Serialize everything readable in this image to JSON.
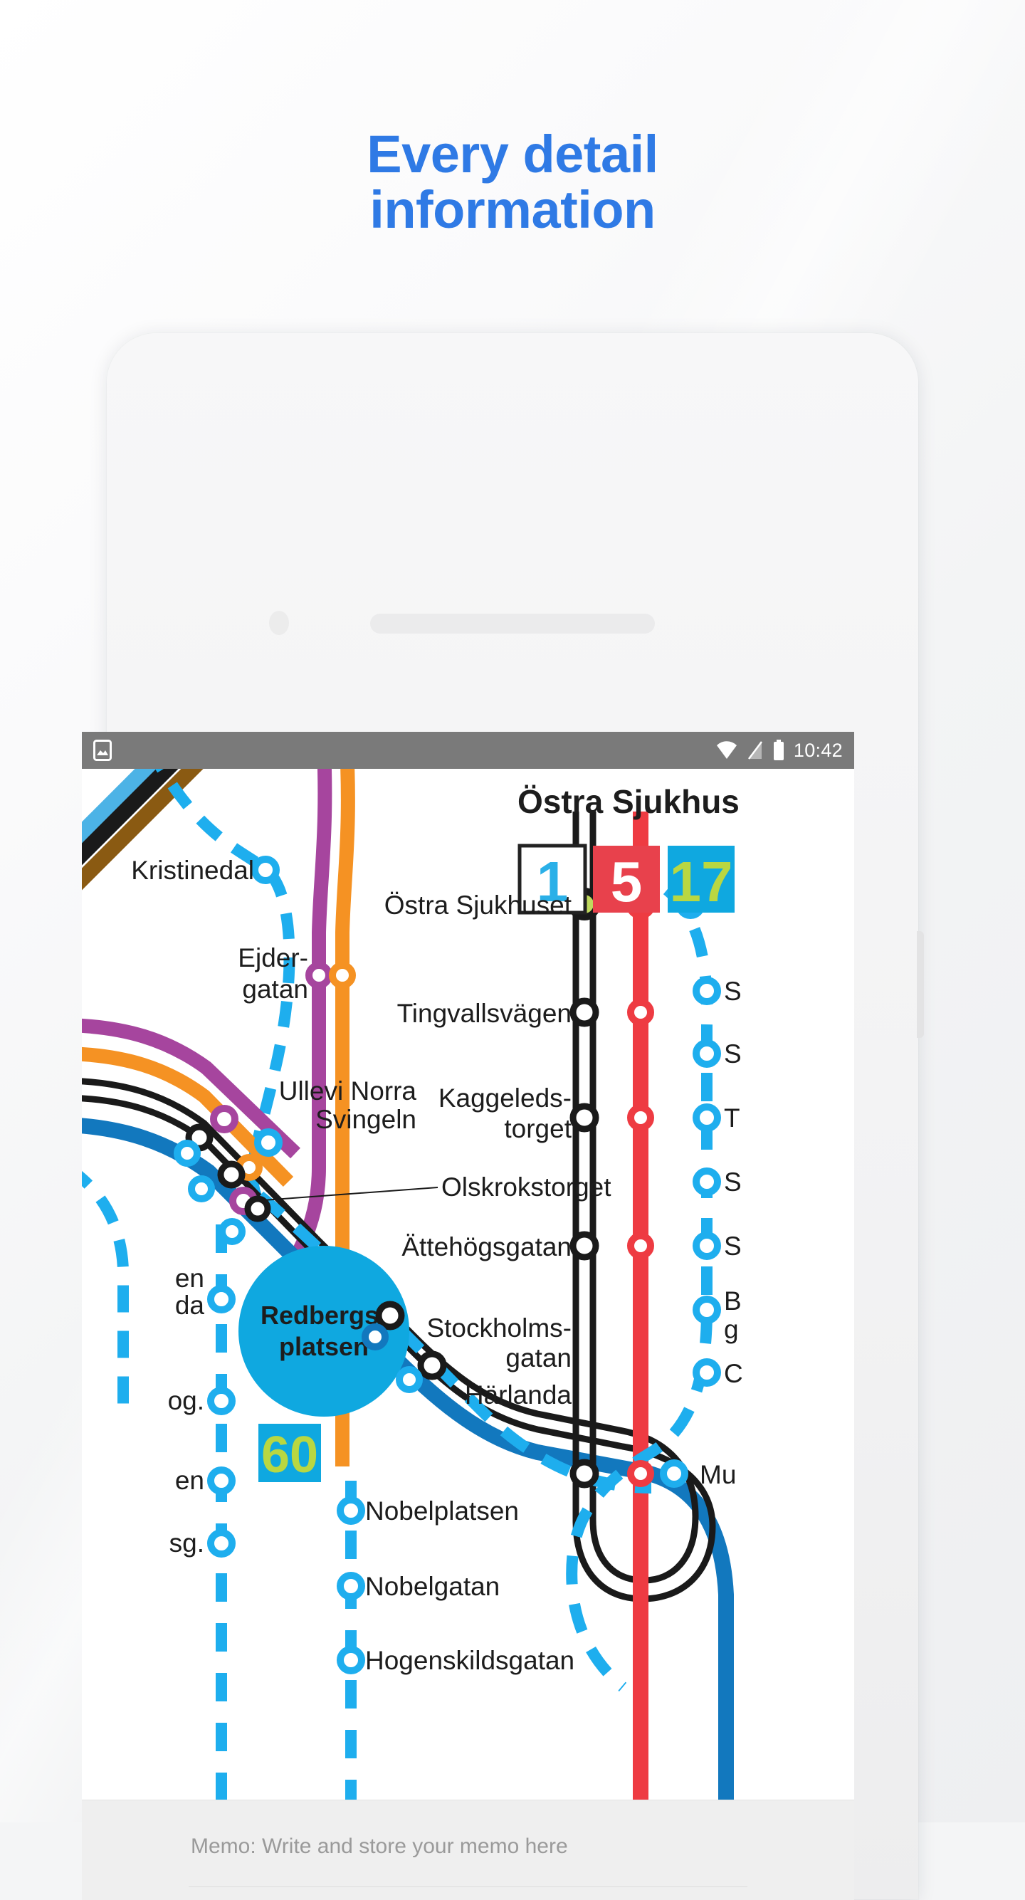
{
  "page": {
    "background_color": "#f4f5f6",
    "accent_color": "#2f7ae5"
  },
  "headline": {
    "line1": "Every detail",
    "line2": "information"
  },
  "phone": {
    "camera_icon": "front-camera",
    "speaker_icon": "earpiece-speaker"
  },
  "statusbar": {
    "background_color": "#7a7a7a",
    "left_icons": [
      "image-notification-icon"
    ],
    "right_icons": [
      "wifi-icon",
      "mobile-signal-off-icon",
      "battery-full-icon"
    ],
    "time": "10:42"
  },
  "map": {
    "title": "Östra Sjukhus",
    "line_badges": [
      {
        "number": "1",
        "bg": "#ffffff",
        "fg": "#2ab0e8",
        "border": "#222222"
      },
      {
        "number": "5",
        "bg": "#e8414c",
        "fg": "#ffffff",
        "border": "none"
      },
      {
        "number": "17",
        "bg": "#0fa8e0",
        "fg": "#b9d741",
        "border": "none"
      }
    ],
    "zone_badge": {
      "number": "60",
      "bg": "#0fa8e0",
      "fg": "#b9d741"
    },
    "interchange_label": "Redbergs-\nplatsen",
    "interchange_line1": "Redbergs-",
    "interchange_line2": "platsen",
    "interchange_color": "#0fa8e0",
    "stations_left": [
      {
        "label": "Kristinedal"
      },
      {
        "label_line1": "Ejder-",
        "label_line2": "gatan"
      },
      {
        "label": "Ullevi Norra"
      },
      {
        "label": "Svingeln"
      },
      {
        "label": "en",
        "cut": true
      },
      {
        "label": "da",
        "cut": true
      },
      {
        "label": "og.",
        "cut": true
      },
      {
        "label": "en",
        "cut": true
      },
      {
        "label": "sg.",
        "cut": true
      },
      {
        "label": "Nobelplatsen"
      },
      {
        "label": "Nobelgatan"
      },
      {
        "label": "Hogenskildsgatan"
      }
    ],
    "stations_center": [
      {
        "label": "Östra Sjukhuset"
      },
      {
        "label": "Tingvallsvägen"
      },
      {
        "label_line1": "Kaggeleds-",
        "label_line2": "torget"
      },
      {
        "label": "Olskrokstorget"
      },
      {
        "label": "Ättehögsgatan"
      },
      {
        "label_line1": "Stockholms-",
        "label_line2": "gatan"
      },
      {
        "label": "Härlanda"
      }
    ],
    "stations_right_cut": [
      {
        "label": "S"
      },
      {
        "label": "S"
      },
      {
        "label": "T"
      },
      {
        "label": "S"
      },
      {
        "label": "S"
      },
      {
        "label_line1": "B",
        "label_line2": "g"
      },
      {
        "label": "C"
      },
      {
        "label": "Mu"
      }
    ],
    "line_colors": {
      "cyan": "#1eaeee",
      "purple": "#a6459e",
      "orange": "#f59223",
      "red": "#ee3b42",
      "black": "#1a1a1a",
      "blue": "#1278be",
      "brown": "#8a5a12",
      "lightblue": "#4cb3e6",
      "green_dot": "#c0d95e"
    }
  },
  "memo": {
    "placeholder": "Memo: Write and store your memo here"
  }
}
